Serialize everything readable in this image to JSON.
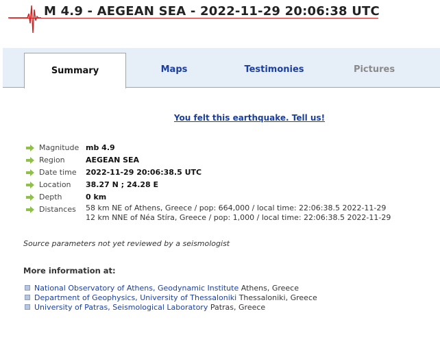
{
  "header": {
    "title": "M 4.9 - AEGEAN SEA - 2022-11-29 20:06:38 UTC"
  },
  "tabs": [
    {
      "label": "Summary",
      "state": "active"
    },
    {
      "label": "Maps",
      "state": "link"
    },
    {
      "label": "Testimonies",
      "state": "link"
    },
    {
      "label": "Pictures",
      "state": "disabled"
    }
  ],
  "felt_link": "You felt this earthquake. Tell us!",
  "params": {
    "magnitude": {
      "label": "Magnitude",
      "value": "mb 4.9"
    },
    "region": {
      "label": "Region",
      "value": "AEGEAN SEA"
    },
    "datetime": {
      "label": "Date time",
      "value": "2022-11-29 20:06:38.5 UTC"
    },
    "location": {
      "label": "Location",
      "value": "38.27 N ; 24.28 E"
    },
    "depth": {
      "label": "Depth",
      "value": "0 km"
    },
    "distances": {
      "label": "Distances",
      "lines": [
        "58 km NE of Athens, Greece / pop: 664,000 / local time: 22:06:38.5 2022-11-29",
        "12 km NNE of Néa Stíra, Greece / pop: 1,000 / local time: 22:06:38.5 2022-11-29"
      ]
    }
  },
  "note": "Source parameters not yet reviewed by a seismologist",
  "more_info": {
    "title": "More information at:",
    "links": [
      {
        "name": "National Observatory of Athens, Geodynamic Institute",
        "location": "Athens, Greece"
      },
      {
        "name": "Department of Geophysics, University of Thessaloniki",
        "location": "Thessaloniki, Greece"
      },
      {
        "name": "University of Patras, Seismological Laboratory",
        "location": "Patras, Greece"
      }
    ]
  },
  "colors": {
    "accent_link": "#1a3fa0",
    "title_underline": "#cc2222",
    "tabbar_bg": "#e6eef8",
    "arrow": "#8fc14a"
  }
}
